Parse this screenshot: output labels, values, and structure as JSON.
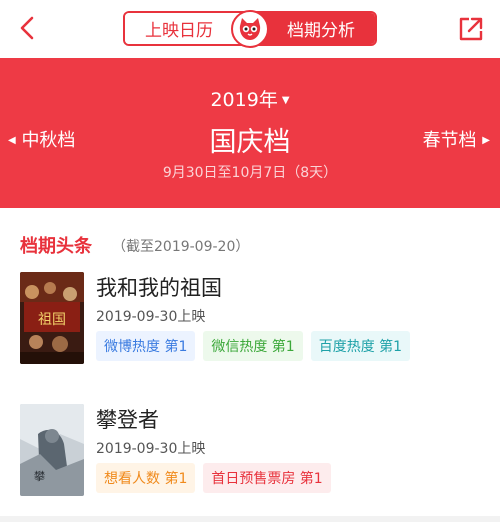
{
  "tabs": {
    "left": "上映日历",
    "right": "档期分析"
  },
  "banner": {
    "year": "2019年",
    "prev": "中秋档",
    "season": "国庆档",
    "next": "春节档",
    "range": "9月30日至10月7日（8天）"
  },
  "headline": {
    "title": "档期头条",
    "subtitle": "（截至2019-09-20）"
  },
  "movies": [
    {
      "title": "我和我的祖国",
      "release": "2019-09-30上映",
      "tags": [
        "微博热度 第1",
        "微信热度 第1",
        "百度热度 第1"
      ]
    },
    {
      "title": "攀登者",
      "release": "2019-09-30上映",
      "tags": [
        "想看人数 第1",
        "首日预售票房 第1"
      ]
    }
  ],
  "colors": {
    "accent": "#e8323c",
    "banner": "#ee3a45"
  },
  "icons": {
    "back": "chevron-left-icon",
    "share": "external-link-icon",
    "logo": "cat-logo-icon"
  }
}
